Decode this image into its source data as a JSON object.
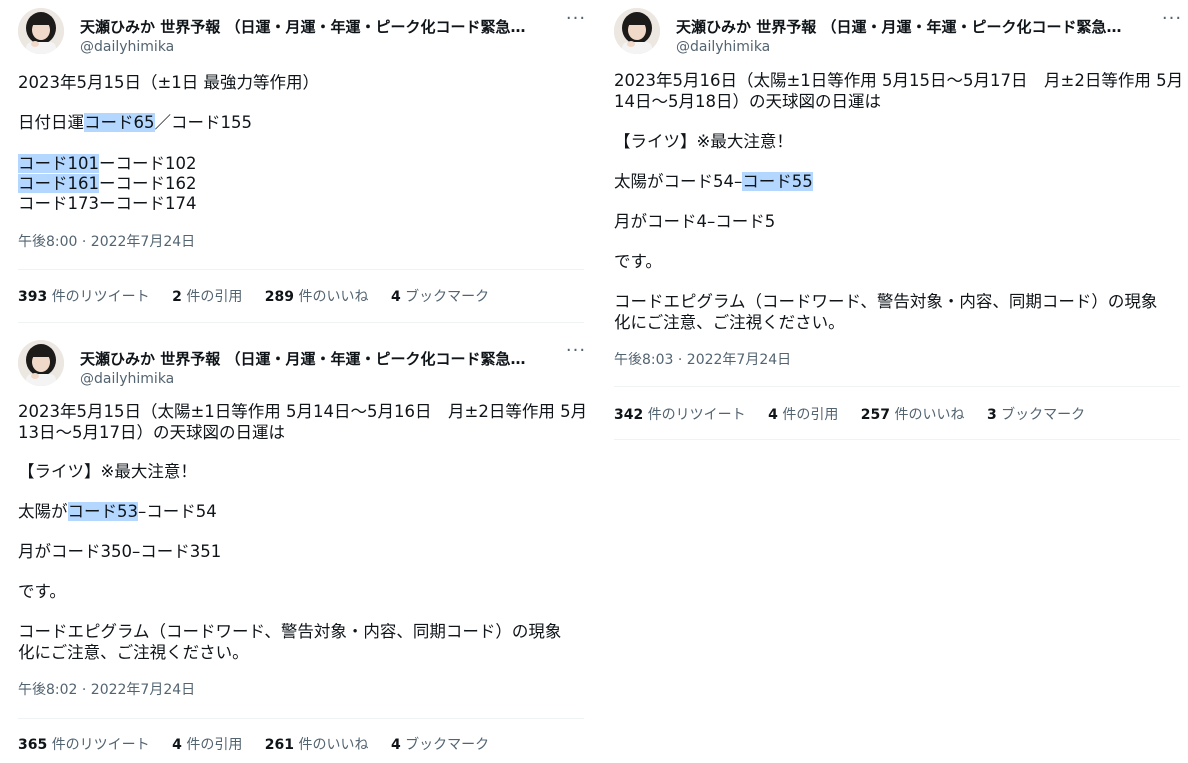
{
  "author": {
    "display_name": "天瀬ひみか 世界予報 （日運・月運・年運・ピーク化コード緊急警…",
    "handle": "@dailyhimika",
    "avatar_icon": "avatar-photo"
  },
  "more_icon": "more-icon",
  "highlight_color": "#b3d7ff",
  "tweets": [
    {
      "text": {
        "l1": "2023年5月15日（±1日 最強力等作用）",
        "l2_pre": "日付日運",
        "l2_hl": "コード65",
        "l2_post": "／コード155",
        "l3_hl": "コード101",
        "l3_post": "ーコード102",
        "l4_hl": "コード161",
        "l4_post": "ーコード162",
        "l5": "コード173ーコード174"
      },
      "timestamp": "午後8:00 · 2022年7月24日",
      "stats": {
        "retweets": "393",
        "retweets_label": "件のリツイート",
        "quotes": "2",
        "quotes_label": "件の引用",
        "likes": "289",
        "likes_label": "件のいいね",
        "bookmarks": "4",
        "bookmarks_label": "ブックマーク"
      }
    },
    {
      "text": {
        "l1": "2023年5月15日（太陽±1日等作用 5月14日〜5月16日　月±2日等作用 5月",
        "l2": "13日〜5月17日）の天球図の日運は",
        "l3": "【ライツ】※最大注意！",
        "l4_pre": "太陽が",
        "l4_hl": "コード53",
        "l4_post": "–コード54",
        "l5": "月がコード350–コード351",
        "l6": "です。",
        "l7": "コードエピグラム（コードワード、警告対象・内容、同期コード）の現象",
        "l8": "化にご注意、ご注視ください。"
      },
      "timestamp": "午後8:02 · 2022年7月24日",
      "stats": {
        "retweets": "365",
        "retweets_label": "件のリツイート",
        "quotes": "4",
        "quotes_label": "件の引用",
        "likes": "261",
        "likes_label": "件のいいね",
        "bookmarks": "4",
        "bookmarks_label": "ブックマーク"
      }
    },
    {
      "text": {
        "l1": "2023年5月16日（太陽±1日等作用 5月15日〜5月17日　月±2日等作用 5月",
        "l2": "14日〜5月18日）の天球図の日運は",
        "l3": "【ライツ】※最大注意！",
        "l4_pre": "太陽がコード54–",
        "l4_hl": "コード55",
        "l5": "月がコード4–コード5",
        "l6": "です。",
        "l7": "コードエピグラム（コードワード、警告対象・内容、同期コード）の現象",
        "l8": "化にご注意、ご注視ください。"
      },
      "timestamp": "午後8:03 · 2022年7月24日",
      "stats": {
        "retweets": "342",
        "retweets_label": "件のリツイート",
        "quotes": "4",
        "quotes_label": "件の引用",
        "likes": "257",
        "likes_label": "件のいいね",
        "bookmarks": "3",
        "bookmarks_label": "ブックマーク"
      }
    }
  ]
}
